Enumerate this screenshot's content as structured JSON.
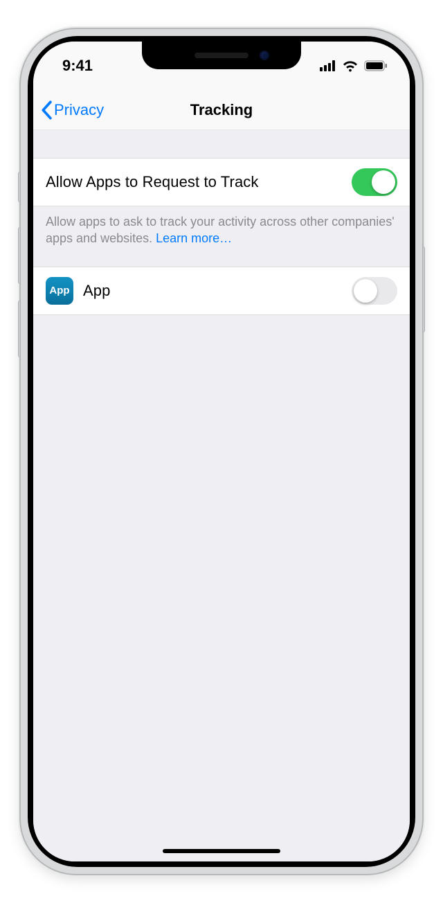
{
  "statusbar": {
    "time": "9:41"
  },
  "nav": {
    "back_label": "Privacy",
    "title": "Tracking"
  },
  "settings": {
    "allow_request": {
      "label": "Allow Apps to Request to Track",
      "on": true
    },
    "footer_text": "Allow apps to ask to track your activity across other companies' apps and websites. ",
    "footer_link": "Learn more…"
  },
  "apps": [
    {
      "name": "App",
      "icon_text": "App",
      "tracking_on": false
    }
  ]
}
